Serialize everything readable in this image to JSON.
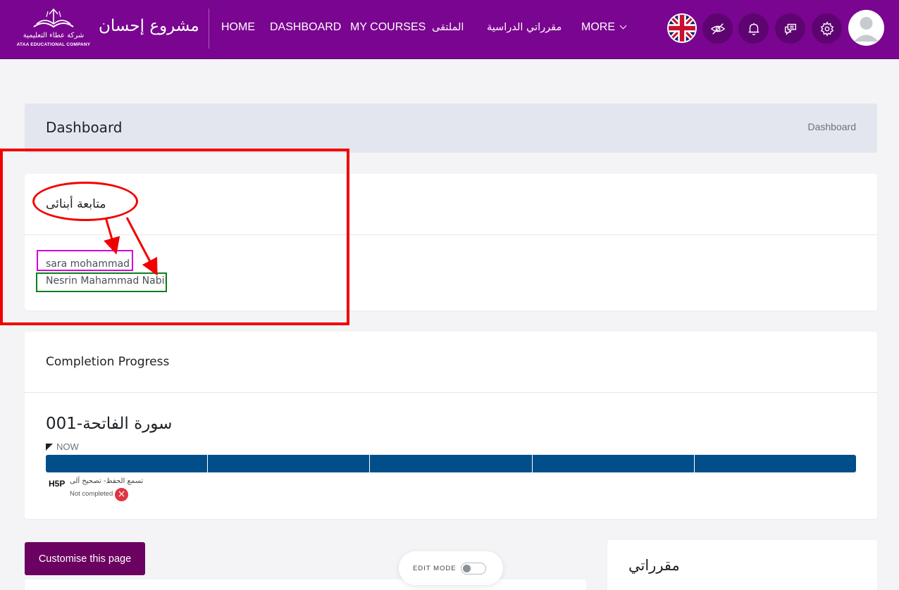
{
  "navbar": {
    "logo_ar": "شركة عطاء التعليمية",
    "logo_en": "ATAA EDUCATIONAL COMPANY",
    "site_name": "مشروع إحسان",
    "links": [
      {
        "label": "HOME"
      },
      {
        "label": "DASHBOARD"
      },
      {
        "label": "MY COURSES"
      },
      {
        "label": "الملتقى"
      },
      {
        "label": "مقرراتي الدراسية"
      },
      {
        "label": "MORE"
      }
    ],
    "icons": [
      "uk-flag-icon",
      "eye-off-icon",
      "bell-icon",
      "chat-icon",
      "gear-icon",
      "user-avatar"
    ]
  },
  "header": {
    "title": "Dashboard",
    "breadcrumb": "Dashboard"
  },
  "children_block": {
    "title": "متابعة أبنائى",
    "children": [
      "sara mohammad",
      "Nesrin Mahammad Nabil"
    ]
  },
  "completion": {
    "title": "Completion Progress",
    "course": "سورة الفاتحة-001",
    "now_label": "NOW",
    "segments": 5,
    "activity_logo": "H5P",
    "activity_name": "تسمع الحفظ- تصحيح آلى",
    "activity_status": "Not completed",
    "status_icon": "×"
  },
  "bottom": {
    "customise_label": "Customise this page",
    "edit_mode_label": "EDIT MODE",
    "my_courses_title": "مقرراتي"
  },
  "colors": {
    "navbar": "#7a0590",
    "progress": "#004f8a",
    "annotation_red": "#f20000",
    "annotation_magenta": "#d000d8",
    "annotation_green": "#0c7f1e",
    "button": "#6b0261"
  }
}
